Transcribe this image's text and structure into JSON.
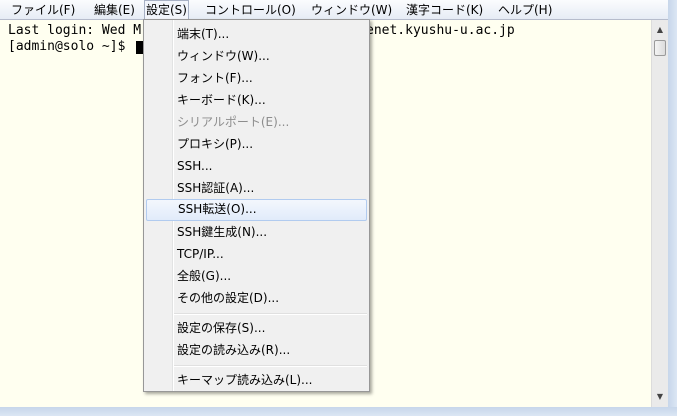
{
  "menubar": {
    "items": [
      {
        "label": "ファイル(F)"
      },
      {
        "label": "編集(E)"
      },
      {
        "label": "設定(S)"
      },
      {
        "label": "コントロール(O)"
      },
      {
        "label": "ウィンドウ(W)"
      },
      {
        "label": "漢字コード(K)"
      },
      {
        "label": "ヘルプ(H)"
      }
    ]
  },
  "terminal": {
    "line1_left": "Last login: Wed M",
    "line1_right": "enet.kyushu-u.ac.jp",
    "line2": "[admin@solo ~]$ "
  },
  "settings_menu": {
    "items": [
      {
        "label": "端末(T)..."
      },
      {
        "label": "ウィンドウ(W)..."
      },
      {
        "label": "フォント(F)..."
      },
      {
        "label": "キーボード(K)..."
      },
      {
        "label": "シリアルポート(E)...",
        "disabled": true
      },
      {
        "label": "プロキシ(P)..."
      },
      {
        "label": "SSH..."
      },
      {
        "label": "SSH認証(A)..."
      },
      {
        "label": "SSH転送(O)...",
        "highlighted": true
      },
      {
        "label": "SSH鍵生成(N)..."
      },
      {
        "label": "TCP/IP..."
      },
      {
        "label": "全般(G)..."
      },
      {
        "label": "その他の設定(D)..."
      },
      {
        "label": "設定の保存(S)..."
      },
      {
        "label": "設定の読み込み(R)..."
      },
      {
        "label": "キーマップ読み込み(L)..."
      }
    ]
  },
  "scrollbar": {
    "up_icon": "triangle-up",
    "down_icon": "triangle-down"
  },
  "colors": {
    "terminal_bg": "#fffff0",
    "menu_bg": "#f0f0f0",
    "highlight_border": "#b1cbef",
    "disabled_text": "#8d8d8d"
  }
}
